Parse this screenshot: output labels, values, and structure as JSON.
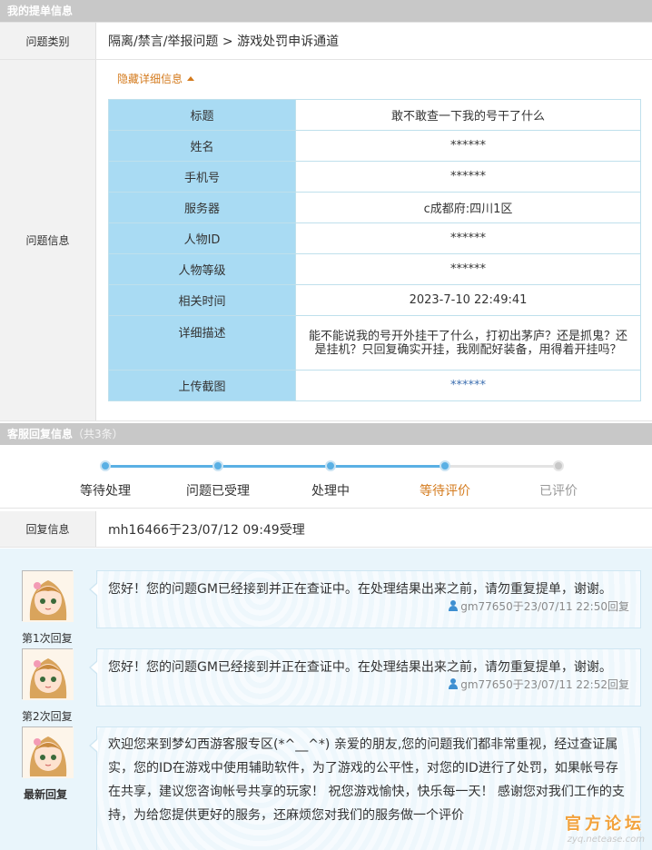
{
  "sections": {
    "ticket_header": "我的提单信息",
    "reply_header": "客服回复信息",
    "reply_count": "（共3条）"
  },
  "category": {
    "label": "问题类别",
    "value": "隔离/禁言/举报问题 > 游戏处罚申诉通道"
  },
  "issue": {
    "label": "问题信息",
    "toggle": "隐藏详细信息",
    "rows": [
      {
        "key": "标题",
        "value": "敢不敢查一下我的号干了什么"
      },
      {
        "key": "姓名",
        "value": "******"
      },
      {
        "key": "手机号",
        "value": "******"
      },
      {
        "key": "服务器",
        "value": "c成都府:四川1区"
      },
      {
        "key": "人物ID",
        "value": "******"
      },
      {
        "key": "人物等级",
        "value": "******"
      },
      {
        "key": "相关时间",
        "value": "2023-7-10 22:49:41"
      },
      {
        "key": "详细描述",
        "value": "能不能说我的号开外挂干了什么，打初出茅庐？还是抓鬼？还是挂机？只回复确实开挂，我刚配好装备，用得着开挂吗？"
      },
      {
        "key": "上传截图",
        "value": "******"
      }
    ]
  },
  "progress": {
    "steps": [
      {
        "label": "等待处理"
      },
      {
        "label": "问题已受理"
      },
      {
        "label": "处理中"
      },
      {
        "label": "等待评价"
      },
      {
        "label": "已评价"
      }
    ],
    "current_step": "等待评价",
    "colors": {
      "done": "#5ab0e4",
      "current_text": "#d47b1e",
      "pending": "#c8c8c8"
    }
  },
  "reply_info": {
    "label": "回复信息",
    "value": "mh16466于23/07/12 09:49受理"
  },
  "replies": [
    {
      "label": "第1次回复",
      "text": "您好！您的问题GM已经接到并正在查证中。在处理结果出来之前，请勿重复提单，谢谢。",
      "meta": "gm77650于23/07/11 22:50回复"
    },
    {
      "label": "第2次回复",
      "text": "您好！您的问题GM已经接到并正在查证中。在处理结果出来之前，请勿重复提单，谢谢。",
      "meta": "gm77650于23/07/11 22:52回复"
    },
    {
      "label": "最新回复",
      "text": "欢迎您来到梦幻西游客服专区(*^__^*) 亲爱的朋友,您的问题我们都非常重视，经过查证属实，您的ID在游戏中使用辅助软件，为了游戏的公平性，对您的ID进行了处罚，如果帐号存在共享，建议您咨询帐号共享的玩家！ 祝您游戏愉快，快乐每一天！ 感谢您对我们工作的支持，为给您提供更好的服务，还麻烦您对我们的服务做一个评价"
    }
  ],
  "watermark": {
    "text": "官方论坛",
    "url": "zyq.netease.com"
  }
}
